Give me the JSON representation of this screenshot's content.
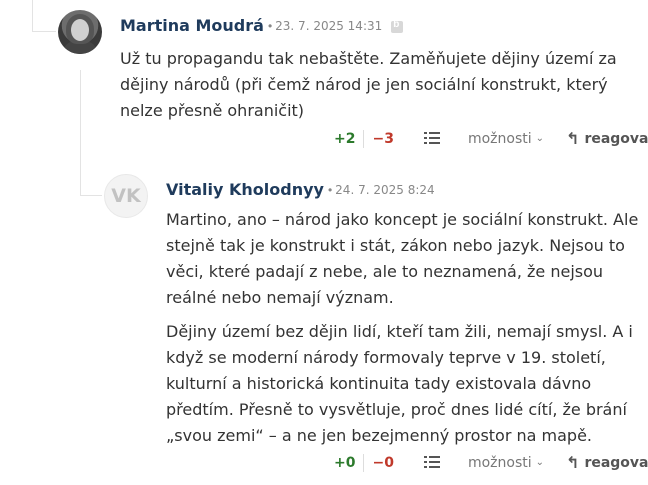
{
  "comments": [
    {
      "author": "Martina Moudrá",
      "date": "23. 7. 2025 14:31",
      "avatar": "photo",
      "paragraphs": [
        "Už tu propagandu tak nebaštěte. Zaměňujete dějiny území za dějiny národů (při čemž národ je jen sociální konstrukt, který nelze přesně ohraničit)"
      ],
      "votes_up": "+2",
      "votes_down": "−3",
      "options_label": "možnosti",
      "reply_label": "reagovat"
    },
    {
      "author": "Vitaliy Kholodnyy",
      "date": "24. 7. 2025 8:24",
      "avatar_initials": "VK",
      "paragraphs": [
        "Martino, ano – národ jako koncept je sociální konstrukt. Ale stejně tak je konstrukt i stát, zákon nebo jazyk. Nejsou to věci, které padají z nebe, ale to neznamená, že nejsou reálné nebo nemají význam.",
        "Dějiny území bez dějin lidí, kteří tam žili, nemají smysl. A i když se moderní národy formovaly teprve v 19. století, kulturní a historická kontinuita tady existovala dávno předtím. Přesně to vysvětluje, proč dnes lidé cítí, že brání „svou zemi“ – a ne jen bezejmenný prostor na mapě."
      ],
      "votes_up": "+0",
      "votes_down": "−0",
      "options_label": "možnosti",
      "reply_label": "reagovat"
    }
  ],
  "colors": {
    "author": "#1f3b5c",
    "vote_up": "#2c7a2c",
    "vote_down": "#c0392b"
  },
  "icons": [
    "edit-icon",
    "list-icon",
    "chevron-down-icon",
    "reply-icon"
  ]
}
